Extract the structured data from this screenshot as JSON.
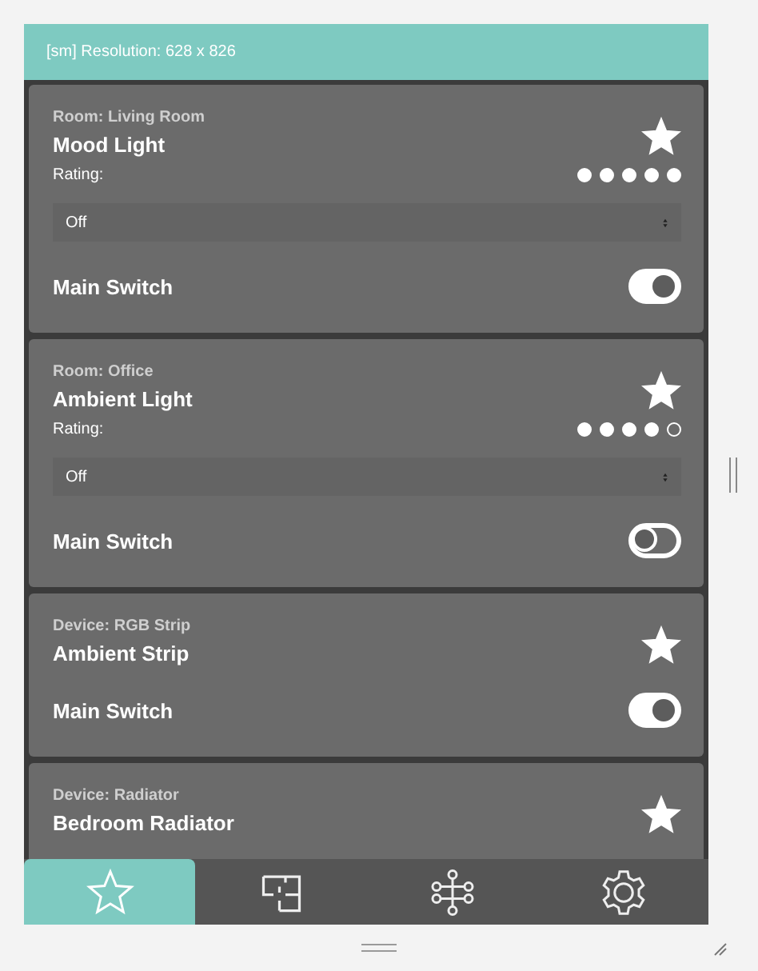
{
  "header": {
    "title": "[sm] Resolution: 628 x 826"
  },
  "cards": [
    {
      "kind": "rated",
      "subtitle": "Room: Living Room",
      "title": "Mood Light",
      "favorite": true,
      "rating_label": "Rating:",
      "stars": 5,
      "dropdown": {
        "value": "Off"
      },
      "switch": {
        "label": "Main Switch",
        "on": true
      }
    },
    {
      "kind": "rated",
      "subtitle": "Room: Office",
      "title": "Ambient Light",
      "favorite": true,
      "rating_label": "Rating:",
      "stars": 4,
      "dropdown": {
        "value": "Off"
      },
      "switch": {
        "label": "Main Switch",
        "on": false
      }
    },
    {
      "kind": "plain",
      "subtitle": "Device: RGB Strip",
      "title": "Ambient Strip",
      "favorite": true,
      "switch": {
        "label": "Main Switch",
        "on": true
      }
    },
    {
      "kind": "plain",
      "subtitle": "Device: Radiator",
      "title": "Bedroom Radiator",
      "favorite": true
    }
  ],
  "tabs": [
    {
      "kind": "favorites",
      "selected": true
    },
    {
      "kind": "rooms",
      "selected": false
    },
    {
      "kind": "devices",
      "selected": false
    },
    {
      "kind": "settings",
      "selected": false
    }
  ]
}
